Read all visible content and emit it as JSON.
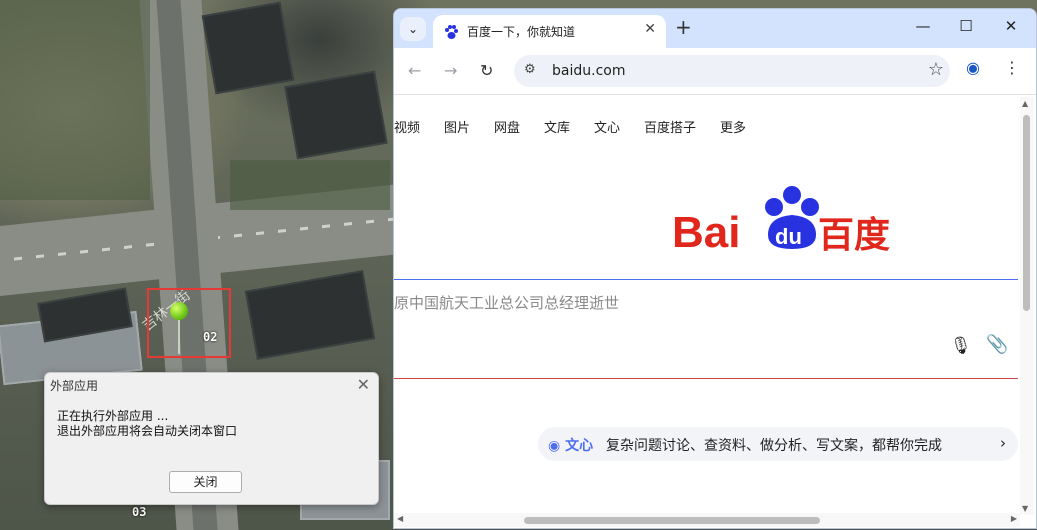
{
  "map": {
    "road_name": "吉林一街",
    "marker_labels": [
      "02",
      "03"
    ]
  },
  "dialog": {
    "title": "外部应用",
    "message_line1": "正在执行外部应用 ...",
    "message_line2": "退出外部应用将会自动关闭本窗口",
    "close_button": "关闭",
    "close_icon": "close-icon"
  },
  "browser": {
    "tab_title": "百度一下，你就知道",
    "url": "baidu.com",
    "new_tab_label": "+",
    "window_controls": [
      "—",
      "☐",
      "✕"
    ]
  },
  "page": {
    "nav_links": [
      "视频",
      "图片",
      "网盘",
      "文库",
      "文心",
      "百度搭子",
      "更多"
    ],
    "logo_text_left": "Bai",
    "logo_text_paw": "du",
    "logo_text_right": "百度",
    "search_query": "原中国航天工业总公司总经理逝世",
    "ai_brand": "文心",
    "ai_prompt": "复杂问题讨论、查资料、做分析、写文案，都帮你完成",
    "colors": {
      "brand_red": "#e1261c",
      "brand_blue": "#2932e1",
      "accent": "#4e6ef2"
    }
  }
}
